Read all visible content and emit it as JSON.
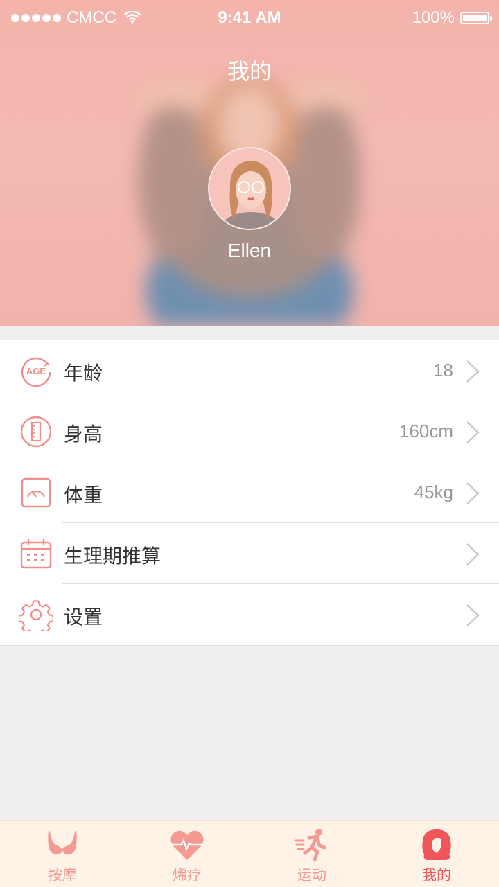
{
  "status_bar": {
    "carrier": "CMCC",
    "time": "9:41 AM",
    "battery": "100%"
  },
  "header": {
    "title": "我的",
    "username": "Ellen"
  },
  "profile_rows": [
    {
      "icon": "age-icon",
      "label": "年龄",
      "value": "18"
    },
    {
      "icon": "ruler-icon",
      "label": "身高",
      "value": "160cm"
    },
    {
      "icon": "scale-icon",
      "label": "体重",
      "value": "45kg"
    },
    {
      "icon": "calendar-icon",
      "label": "生理期推算",
      "value": ""
    },
    {
      "icon": "gear-icon",
      "label": "设置",
      "value": ""
    }
  ],
  "tabs": [
    {
      "icon": "bra-icon",
      "label": "按摩"
    },
    {
      "icon": "heartbeat-icon",
      "label": "烯疗"
    },
    {
      "icon": "running-icon",
      "label": "运动"
    },
    {
      "icon": "girl-profile-icon",
      "label": "我的",
      "active": true
    }
  ],
  "colors": {
    "accent": "#f28f8a",
    "active": "#f0555a",
    "tabbar_bg": "#fef3e6"
  }
}
